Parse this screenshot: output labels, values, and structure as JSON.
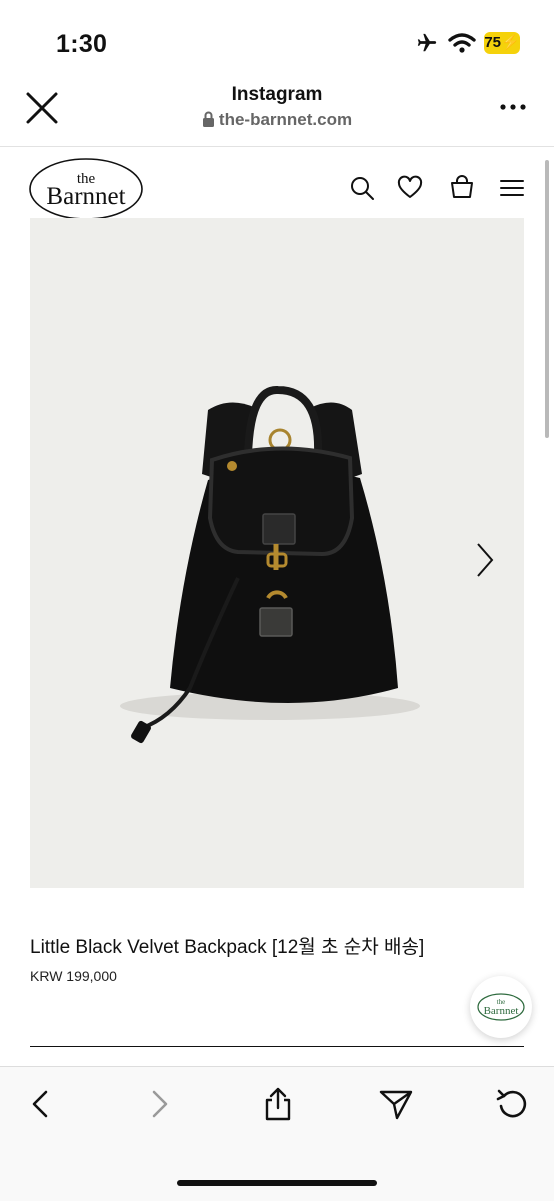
{
  "status_bar": {
    "time": "1:30",
    "battery": "75"
  },
  "browser": {
    "title": "Instagram",
    "url": "the-barnnet.com"
  },
  "site": {
    "logo_top": "the",
    "logo_name": "Barnnet"
  },
  "product": {
    "name": "Little Black Velvet Backpack [12월 초 순차 배송]",
    "price": "KRW 199,000"
  },
  "colors": {
    "battery": "#f5d20b",
    "image_bg": "#eeeeeb"
  }
}
